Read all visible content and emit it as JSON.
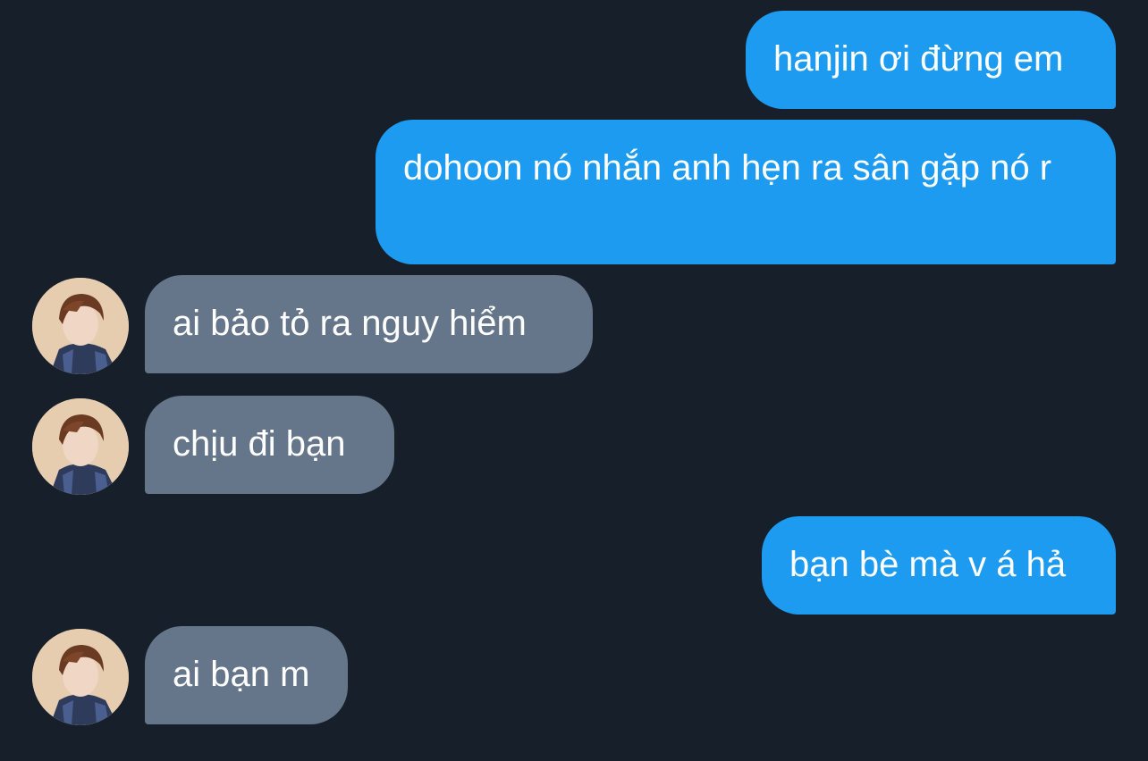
{
  "conversation": {
    "messages": [
      {
        "direction": "outgoing",
        "text": "hanjin ơi đừng em"
      },
      {
        "direction": "outgoing",
        "text": "dohoon nó nhắn anh hẹn ra sân gặp nó r"
      },
      {
        "direction": "incoming",
        "text": "ai bảo tỏ ra nguy hiểm",
        "avatar_icon": "user-avatar"
      },
      {
        "direction": "incoming",
        "text": "chịu đi bạn",
        "avatar_icon": "user-avatar"
      },
      {
        "direction": "outgoing",
        "text": "bạn bè mà v á hả"
      },
      {
        "direction": "incoming",
        "text": "ai bạn m",
        "avatar_icon": "user-avatar"
      }
    ]
  },
  "colors": {
    "background": "#17202a",
    "outgoing_bubble": "#1d9bf0",
    "incoming_bubble": "#66768a",
    "text": "#ffffff"
  }
}
